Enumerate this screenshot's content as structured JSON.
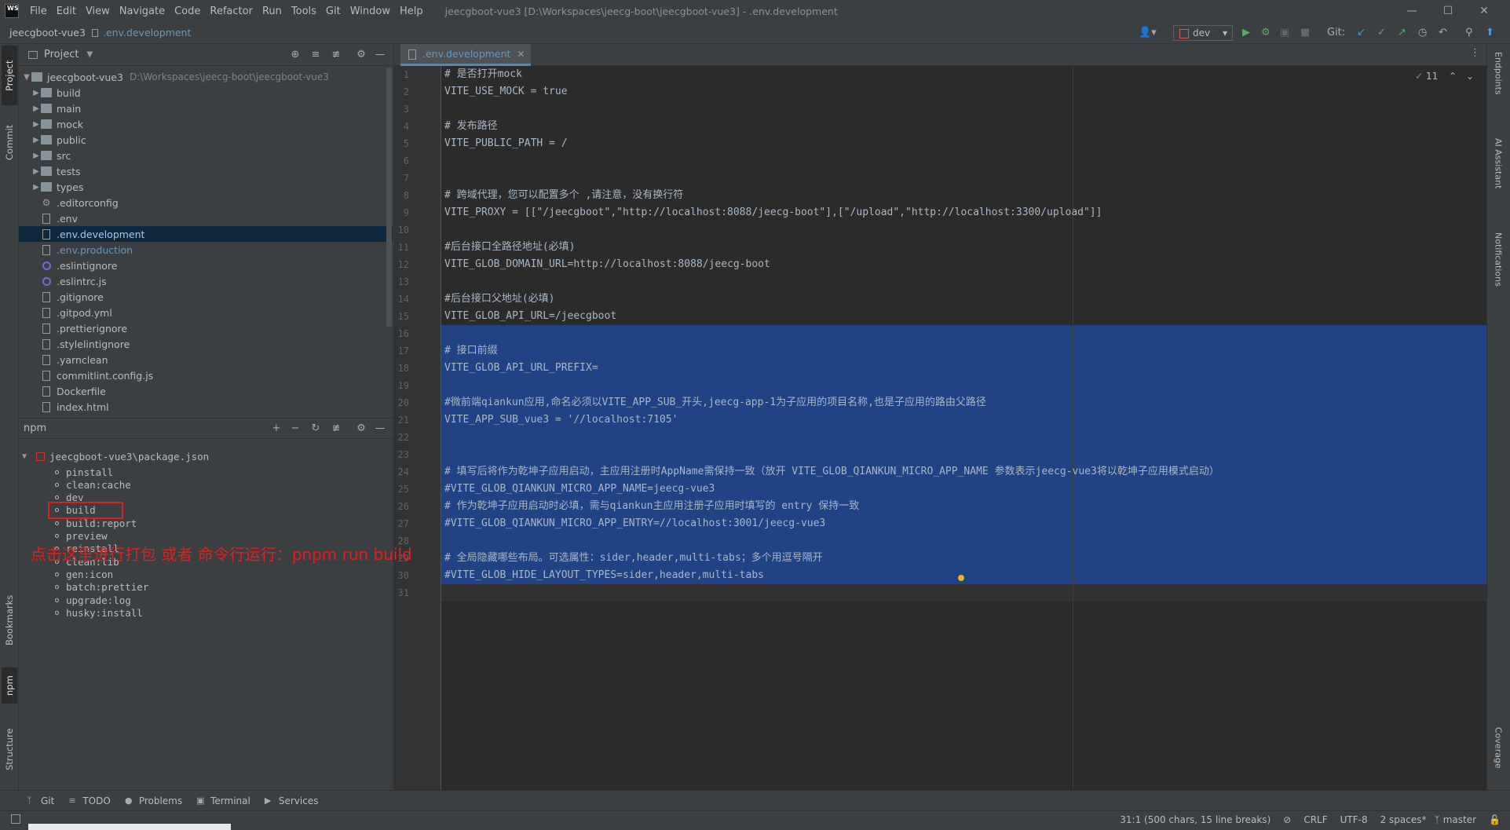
{
  "titlebar": {
    "menus": [
      "File",
      "Edit",
      "View",
      "Navigate",
      "Code",
      "Refactor",
      "Run",
      "Tools",
      "Git",
      "Window",
      "Help"
    ],
    "title": "jeecgboot-vue3 [D:\\Workspaces\\jeecg-boot\\jeecgboot-vue3] - .env.development",
    "logo": "WS"
  },
  "navbar": {
    "project": "jeecgboot-vue3",
    "file": ".env.development",
    "run_config": "dev",
    "git_label": "Git:"
  },
  "left_stripe": {
    "tabs": [
      "Project",
      "Commit",
      "Bookmarks",
      "npm",
      "Structure"
    ]
  },
  "right_stripe": {
    "tabs": [
      "Endpoints",
      "AI Assistant",
      "Notifications",
      "Coverage"
    ]
  },
  "project_panel": {
    "title": "Project",
    "root": {
      "name": "jeecgboot-vue3",
      "path": "D:\\Workspaces\\jeecg-boot\\jeecgboot-vue3"
    },
    "items": [
      {
        "name": "build",
        "kind": "folder"
      },
      {
        "name": "main",
        "kind": "folder"
      },
      {
        "name": "mock",
        "kind": "folder"
      },
      {
        "name": "public",
        "kind": "folder"
      },
      {
        "name": "src",
        "kind": "folder"
      },
      {
        "name": "tests",
        "kind": "folder"
      },
      {
        "name": "types",
        "kind": "folder"
      },
      {
        "name": ".editorconfig",
        "kind": "gear"
      },
      {
        "name": ".env",
        "kind": "file"
      },
      {
        "name": ".env.development",
        "kind": "file",
        "selected": true
      },
      {
        "name": ".env.production",
        "kind": "file",
        "blue": true
      },
      {
        "name": ".eslintignore",
        "kind": "circle"
      },
      {
        "name": ".eslintrc.js",
        "kind": "circle"
      },
      {
        "name": ".gitignore",
        "kind": "file"
      },
      {
        "name": ".gitpod.yml",
        "kind": "file"
      },
      {
        "name": ".prettierignore",
        "kind": "file"
      },
      {
        "name": ".stylelintignore",
        "kind": "file"
      },
      {
        "name": ".yarnclean",
        "kind": "file"
      },
      {
        "name": "commitlint.config.js",
        "kind": "file"
      },
      {
        "name": "Dockerfile",
        "kind": "file"
      },
      {
        "name": "index.html",
        "kind": "file"
      }
    ]
  },
  "npm_panel": {
    "title": "npm",
    "package": "jeecgboot-vue3\\package.json",
    "scripts": [
      "pinstall",
      "clean:cache",
      "dev",
      "build",
      "build:report",
      "preview",
      "reinstall",
      "clean:lib",
      "gen:icon",
      "batch:prettier",
      "upgrade:log",
      "husky:install"
    ],
    "annotation": "点击这里进行打包   或者   命令行运行：pnpm run build"
  },
  "editor": {
    "tab": ".env.development",
    "inspection_count": "11",
    "lines": [
      "# 是否打开mock",
      "VITE_USE_MOCK = true",
      "",
      "# 发布路径",
      "VITE_PUBLIC_PATH = /",
      "",
      "",
      "# 跨域代理，您可以配置多个 ,请注意，没有换行符",
      "VITE_PROXY = [[\"/jeecgboot\",\"http://localhost:8088/jeecg-boot\"],[\"/upload\",\"http://localhost:3300/upload\"]]",
      "",
      "#后台接口全路径地址(必填)",
      "VITE_GLOB_DOMAIN_URL=http://localhost:8088/jeecg-boot",
      "",
      "#后台接口父地址(必填)",
      "VITE_GLOB_API_URL=/jeecgboot",
      "",
      "# 接口前缀",
      "VITE_GLOB_API_URL_PREFIX=",
      "",
      "#微前端qiankun应用,命名必须以VITE_APP_SUB_开头,jeecg-app-1为子应用的项目名称,也是子应用的路由父路径",
      "VITE_APP_SUB_vue3 = '//localhost:7105'",
      "",
      "",
      "# 填写后将作为乾坤子应用启动，主应用注册时AppName需保持一致（放开 VITE_GLOB_QIANKUN_MICRO_APP_NAME 参数表示jeecg-vue3将以乾坤子应用模式启动）",
      "#VITE_GLOB_QIANKUN_MICRO_APP_NAME=jeecg-vue3",
      "# 作为乾坤子应用启动时必填，需与qiankun主应用注册子应用时填写的 entry 保持一致",
      "#VITE_GLOB_QIANKUN_MICRO_APP_ENTRY=//localhost:3001/jeecg-vue3",
      "",
      "# 全局隐藏哪些布局。可选属性：sider,header,multi-tabs；多个用逗号隔开",
      "#VITE_GLOB_HIDE_LAYOUT_TYPES=sider,header,multi-tabs",
      ""
    ]
  },
  "bottombar": {
    "tools": [
      "Git",
      "TODO",
      "Problems",
      "Terminal",
      "Services"
    ]
  },
  "statusbar": {
    "position": "31:1 (500 chars, 15 line breaks)",
    "line_sep": "CRLF",
    "encoding": "UTF-8",
    "indent": "2 spaces*",
    "branch": "master"
  }
}
